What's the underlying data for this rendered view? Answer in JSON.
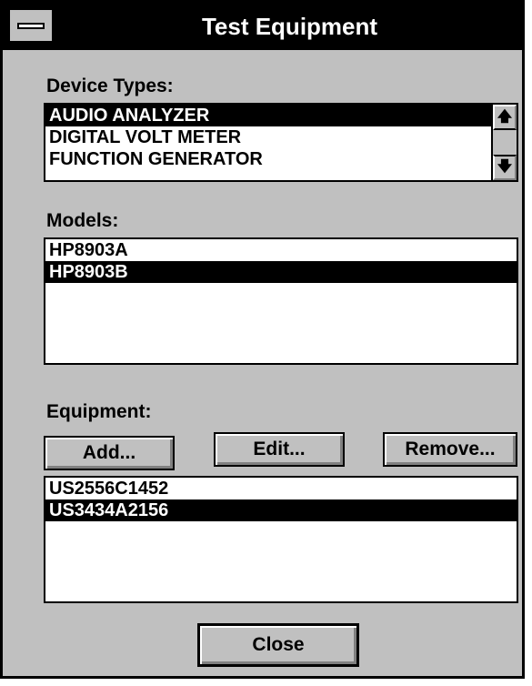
{
  "window": {
    "title": "Test Equipment"
  },
  "device_types": {
    "label": "Device Types:",
    "items": [
      "AUDIO ANALYZER",
      "DIGITAL VOLT METER",
      "FUNCTION GENERATOR"
    ],
    "selected_index": 0,
    "scroll_up_icon": "arrow-up-icon",
    "scroll_down_icon": "arrow-down-icon"
  },
  "models": {
    "label": "Models:",
    "items": [
      "HP8903A",
      "HP8903B"
    ],
    "selected_index": 1
  },
  "equipment": {
    "label": "Equipment:",
    "add_label": "Add...",
    "edit_label": "Edit...",
    "remove_label": "Remove...",
    "items": [
      "US2556C1452",
      "US3434A2156"
    ],
    "selected_index": 1
  },
  "close_label": "Close"
}
